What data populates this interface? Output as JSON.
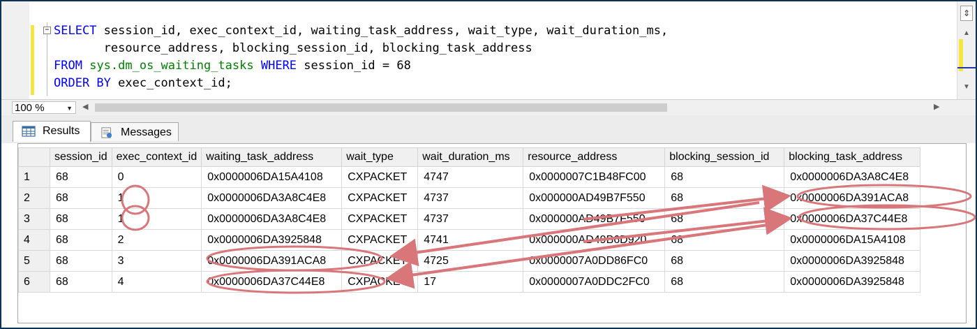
{
  "editor": {
    "lines": [
      [
        {
          "t": "SELECT",
          "c": "kw"
        },
        {
          "t": " session_id, exec_context_id, waiting_task_address, wait_type, wait_duration_ms,",
          "c": ""
        }
      ],
      [
        {
          "t": "       resource_address, blocking_session_id, blocking_task_address",
          "c": ""
        }
      ],
      [
        {
          "t": "FROM",
          "c": "kw"
        },
        {
          "t": " ",
          "c": ""
        },
        {
          "t": "sys.dm_os_waiting_tasks",
          "c": "obj"
        },
        {
          "t": " ",
          "c": ""
        },
        {
          "t": "WHERE",
          "c": "kw"
        },
        {
          "t": " session_id = 68",
          "c": ""
        }
      ],
      [
        {
          "t": "ORDER BY",
          "c": "kw"
        },
        {
          "t": " exec_context_id;",
          "c": ""
        }
      ]
    ],
    "collapse_glyph": "−"
  },
  "toolbar": {
    "zoom_value": "100 %"
  },
  "tabs": [
    {
      "label": "Results",
      "icon": "grid-icon"
    },
    {
      "label": "Messages",
      "icon": "messages-icon"
    }
  ],
  "grid": {
    "columns": [
      "session_id",
      "exec_context_id",
      "waiting_task_address",
      "wait_type",
      "wait_duration_ms",
      "resource_address",
      "blocking_session_id",
      "blocking_task_address"
    ],
    "rows": [
      [
        "1",
        "68",
        "0",
        "0x0000006DA15A4108",
        "CXPACKET",
        "4747",
        "0x0000007C1B48FC00",
        "68",
        "0x0000006DA3A8C4E8"
      ],
      [
        "2",
        "68",
        "1",
        "0x0000006DA3A8C4E8",
        "CXPACKET",
        "4737",
        "0x000000AD49B7F550",
        "68",
        "0x0000006DA391ACA8"
      ],
      [
        "3",
        "68",
        "1",
        "0x0000006DA3A8C4E8",
        "CXPACKET",
        "4737",
        "0x000000AD49B7F550",
        "68",
        "0x0000006DA37C44E8"
      ],
      [
        "4",
        "68",
        "2",
        "0x0000006DA3925848",
        "CXPACKET",
        "4741",
        "0x000000AD49B6D920",
        "68",
        "0x0000006DA15A4108"
      ],
      [
        "5",
        "68",
        "3",
        "0x0000006DA391ACA8",
        "CXPACKET",
        "4725",
        "0x0000007A0DD86FC0",
        "68",
        "0x0000006DA3925848"
      ],
      [
        "6",
        "68",
        "4",
        "0x0000006DA37C44E8",
        "CXPACKET",
        "17",
        "0x0000007A0DDC2FC0",
        "68",
        "0x0000006DA3925848"
      ]
    ]
  },
  "annotation_color": "#d9767a"
}
